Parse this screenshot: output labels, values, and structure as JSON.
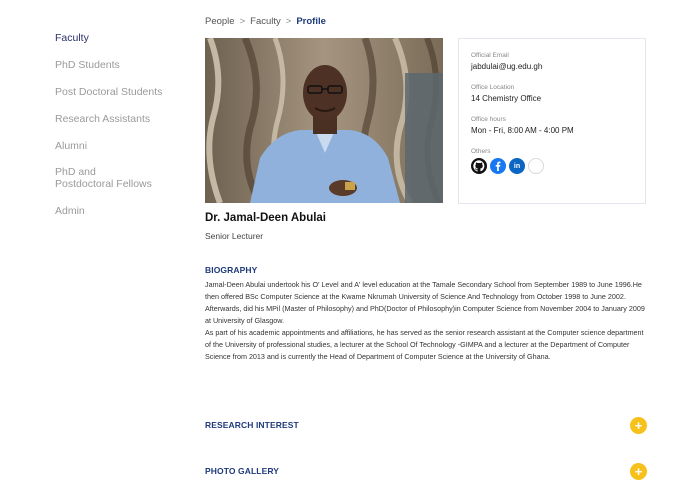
{
  "sidebar": {
    "items": [
      {
        "label": "Faculty",
        "active": true
      },
      {
        "label": "PhD Students"
      },
      {
        "label": "Post Doctoral Students"
      },
      {
        "label": "Research Assistants"
      },
      {
        "label": "Alumni"
      },
      {
        "label_line1": "PhD and",
        "label_line2": "Postdoctoral Fellows"
      },
      {
        "label": "Admin"
      }
    ]
  },
  "breadcrumb": {
    "items": [
      "People",
      "Faculty",
      "Profile"
    ],
    "separator": ">"
  },
  "profile": {
    "name": "Dr. Jamal-Deen Abulai",
    "title": "Senior Lecturer"
  },
  "info": {
    "email_label": "Official Email",
    "email": "jabdulai@ug.edu.gh",
    "location_label": "Office Location",
    "location": "14 Chemistry Office",
    "hours_label": "Office hours",
    "hours": "Mon - Fri, 8:00 AM - 4:00 PM",
    "others_label": "Others",
    "socials": [
      "github-icon",
      "facebook-icon",
      "linkedin-icon",
      "empty-social-icon"
    ],
    "linkedin_text": "in"
  },
  "biography": {
    "heading": "BIOGRAPHY",
    "text": "Jamal-Deen Abulai undertook his O' Level and A' level education at the Tamale Secondary School from September 1989 to June 1996.He then offered BSc Computer Science at the Kwame Nkrumah University of Science And Technology from October 1998 to June 2002. Afterwards, did his MPil (Master of Philosophy) and PhD(Doctor of Philosophy)in Computer Science from November 2004 to January 2009 at University of Glasgow.",
    "text2": "As part of his academic appointments and affiliations, he has served as the senior research assistant at the Computer science department of the University of professional studies, a lecturer at the School Of Technology -GIMPA and a lecturer at the Department of Computer Science from 2013 and is currently the Head of Department of Computer Science at the University of Ghana."
  },
  "sections": {
    "research": "RESEARCH INTEREST",
    "gallery": "PHOTO GALLERY",
    "expand_symbol": "+"
  },
  "colors": {
    "accent_yellow": "#f7c11c",
    "heading_blue": "#1f3a7a",
    "sidebar_active": "#2a2f6b"
  }
}
